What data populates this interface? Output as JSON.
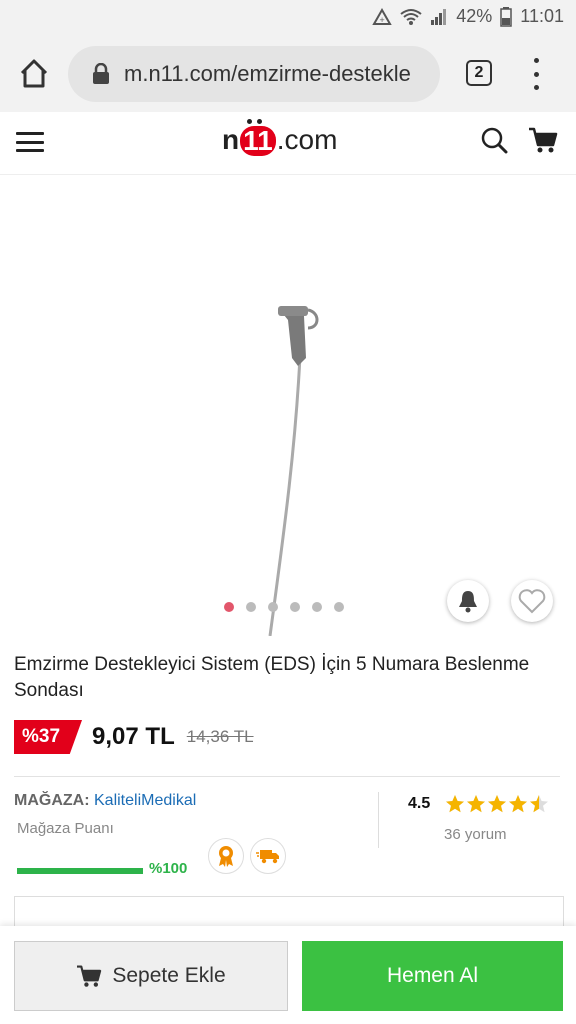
{
  "status_bar": {
    "battery": "42%",
    "time": "11:01"
  },
  "browser": {
    "url": "m.n11.com/emzirme-destekle",
    "tab_count": "2"
  },
  "site": {
    "logo_prefix": "n",
    "logo_ones": "11",
    "logo_suffix": ".com"
  },
  "gallery": {
    "slide_count": 6,
    "active_slide": 0
  },
  "product": {
    "title": "Emzirme Destekleyici Sistem (EDS) İçin 5 Numara Beslenme Sondası",
    "discount": "%37",
    "price": "9,07 TL",
    "old_price": "14,36 TL"
  },
  "store": {
    "label": "MAĞAZA:",
    "name": "KaliteliMedikal",
    "score_label": "Mağaza Puanı",
    "score": "%100",
    "score_fraction": 1.0,
    "rating": "4.5",
    "stars": 4.5,
    "reviews": "36 yorum"
  },
  "actions": {
    "add_to_cart": "Sepete Ekle",
    "buy_now": "Hemen Al"
  },
  "colors": {
    "brand_red": "#e2001a",
    "green": "#3bc142",
    "link_blue": "#1b6cb5",
    "star": "#f5b400"
  }
}
